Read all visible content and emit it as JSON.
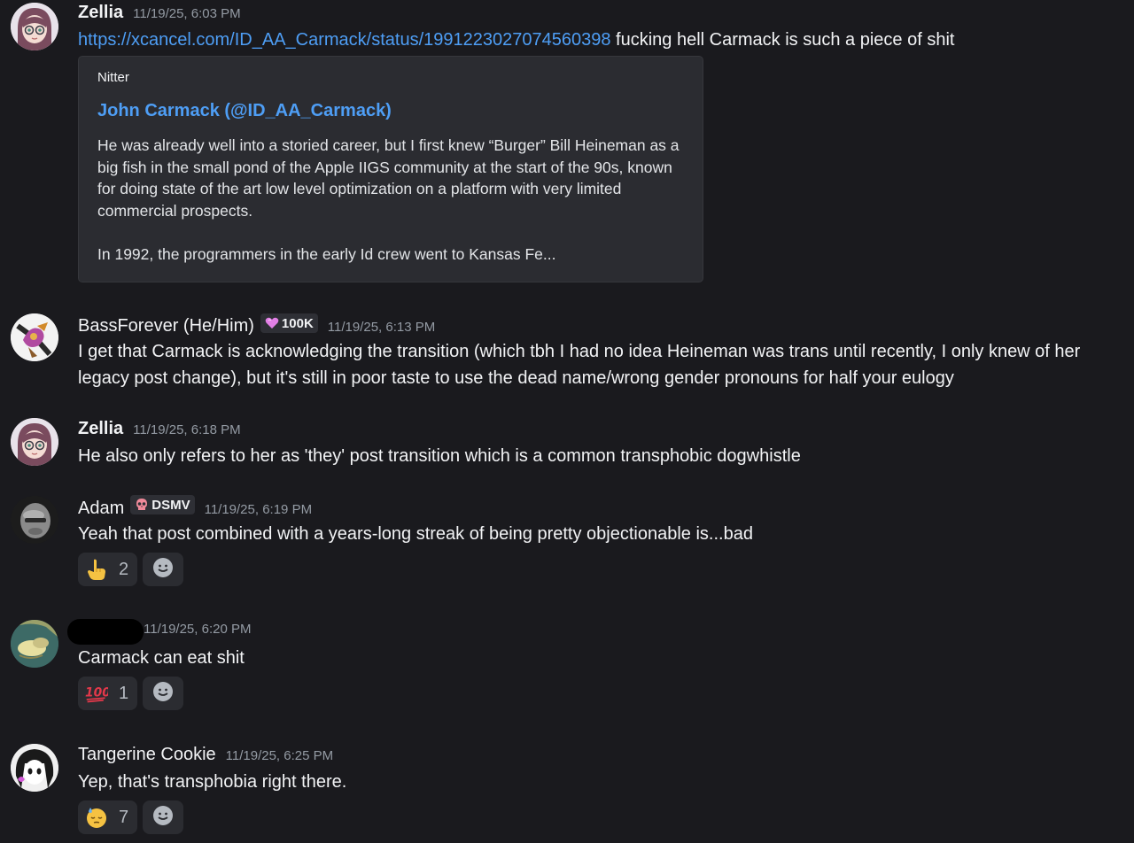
{
  "messages": [
    {
      "author": "Zellia",
      "timestamp": "11/19/25, 6:03 PM",
      "link": "https://xcancel.com/ID_AA_Carmack/status/1991223027074560398",
      "text": "fucking hell Carmack is such a piece of shit",
      "embed": {
        "provider": "Nitter",
        "title": "John Carmack (@ID_AA_Carmack)",
        "description": "He was already well into a storied career, but I first knew “Burger” Bill Heineman as a big fish in the small pond of the Apple IIGS community at the start of the 90s, known for doing state of the art low level optimization on a platform with very limited commercial prospects.\n\nIn 1992, the programmers in the early Id crew went to Kansas Fe..."
      }
    },
    {
      "author": "BassForever (He/Him)",
      "tag": "100K",
      "timestamp": "11/19/25, 6:13 PM",
      "text": "I get that Carmack is acknowledging the transition (which tbh I had no idea Heineman was trans until recently, I only knew of her legacy post change), but it's still in poor taste to use the dead name/wrong gender pronouns for half your eulogy"
    },
    {
      "author": "Zellia",
      "timestamp": "11/19/25, 6:18 PM",
      "text": "He also only refers to her as 'they' post transition which is a common transphobic dogwhistle"
    },
    {
      "author": "Adam",
      "tag": "DSMV",
      "timestamp": "11/19/25, 6:19 PM",
      "text": "Yeah that post combined with a years-long streak of being pretty objectionable is...bad",
      "reactions": [
        {
          "emoji": "point-up-hand",
          "count": "2"
        }
      ]
    },
    {
      "author": "",
      "timestamp": "11/19/25, 6:20 PM",
      "text": "Carmack can eat shit",
      "reactions": [
        {
          "emoji": "hundred-points",
          "count": "1"
        }
      ]
    },
    {
      "author": "Tangerine Cookie",
      "timestamp": "11/19/25, 6:25 PM",
      "text": "Yep, that's transphobia right there.",
      "reactions": [
        {
          "emoji": "sleepy-sweat-face",
          "count": "7"
        }
      ]
    }
  ],
  "colors": {
    "background": "#1a1a1e",
    "link": "#4e9ef5",
    "embed_background": "#2b2c31",
    "muted_text": "#949ba4"
  }
}
